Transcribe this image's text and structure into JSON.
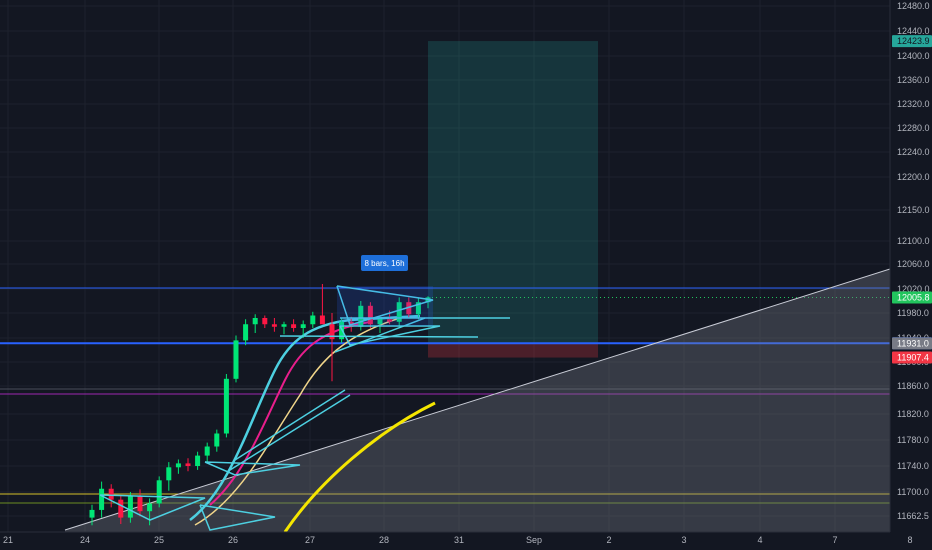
{
  "chart_data": {
    "type": "candlestick",
    "y_axis": {
      "labels": [
        "12480.0",
        "12440.0",
        "12400.0",
        "12360.0",
        "12320.0",
        "12280.0",
        "12240.0",
        "12200.0",
        "12150.0",
        "12100.0",
        "12060.0",
        "12020.0",
        "11980.0",
        "11940.0",
        "11900.0",
        "11860.0",
        "11820.0",
        "11780.0",
        "11740.0",
        "11700.0",
        "11662.5"
      ],
      "values": [
        12480,
        12440,
        12400,
        12360,
        12320,
        12280,
        12240,
        12200,
        12150,
        12100,
        12060,
        12020,
        11980,
        11940,
        11900,
        11860,
        11820,
        11780,
        11740,
        11700,
        11662.5
      ]
    },
    "x_axis": {
      "labels": [
        "21",
        "24",
        "25",
        "26",
        "27",
        "28",
        "31",
        "Sep",
        "2",
        "3",
        "4",
        "7",
        "8"
      ]
    },
    "price_badges": [
      {
        "label": "12423.9",
        "value": 12423.9,
        "bg": "#26a69a",
        "fg": "dark"
      },
      {
        "label": "12005.8",
        "value": 12005.8,
        "bg": "#22c55e",
        "fg": "light"
      },
      {
        "label": "11931.3",
        "value": 11931.3,
        "bg": "#2962ff",
        "fg": "light"
      },
      {
        "label": "11931.0",
        "value": 11931.0,
        "bg": "#787b86",
        "fg": "light"
      },
      {
        "label": "11907.4",
        "value": 11907.4,
        "bg": "#f23645",
        "fg": "light"
      }
    ],
    "range_tooltip": "8 bars, 16h",
    "candles": [
      {
        "o": 11660,
        "h": 11680,
        "l": 11648,
        "c": 11672
      },
      {
        "o": 11672,
        "h": 11716,
        "l": 11660,
        "c": 11705
      },
      {
        "o": 11705,
        "h": 11712,
        "l": 11676,
        "c": 11688
      },
      {
        "o": 11688,
        "h": 11694,
        "l": 11650,
        "c": 11660
      },
      {
        "o": 11660,
        "h": 11700,
        "l": 11652,
        "c": 11694
      },
      {
        "o": 11694,
        "h": 11704,
        "l": 11662,
        "c": 11670
      },
      {
        "o": 11670,
        "h": 11690,
        "l": 11648,
        "c": 11682
      },
      {
        "o": 11682,
        "h": 11724,
        "l": 11676,
        "c": 11718
      },
      {
        "o": 11718,
        "h": 11746,
        "l": 11702,
        "c": 11738
      },
      {
        "o": 11738,
        "h": 11750,
        "l": 11728,
        "c": 11744
      },
      {
        "o": 11744,
        "h": 11752,
        "l": 11732,
        "c": 11740
      },
      {
        "o": 11740,
        "h": 11762,
        "l": 11734,
        "c": 11756
      },
      {
        "o": 11756,
        "h": 11776,
        "l": 11744,
        "c": 11770
      },
      {
        "o": 11770,
        "h": 11796,
        "l": 11762,
        "c": 11790
      },
      {
        "o": 11790,
        "h": 11880,
        "l": 11784,
        "c": 11872
      },
      {
        "o": 11872,
        "h": 11944,
        "l": 11866,
        "c": 11936
      },
      {
        "o": 11936,
        "h": 11970,
        "l": 11928,
        "c": 11962
      },
      {
        "o": 11962,
        "h": 11978,
        "l": 11948,
        "c": 11972
      },
      {
        "o": 11972,
        "h": 11976,
        "l": 11956,
        "c": 11962
      },
      {
        "o": 11962,
        "h": 11972,
        "l": 11950,
        "c": 11958
      },
      {
        "o": 11958,
        "h": 11966,
        "l": 11946,
        "c": 11962
      },
      {
        "o": 11962,
        "h": 11970,
        "l": 11950,
        "c": 11956
      },
      {
        "o": 11956,
        "h": 11968,
        "l": 11940,
        "c": 11962
      },
      {
        "o": 11962,
        "h": 11982,
        "l": 11956,
        "c": 11976
      },
      {
        "o": 11976,
        "h": 12028,
        "l": 11970,
        "c": 11962
      },
      {
        "o": 11962,
        "h": 11980,
        "l": 11868,
        "c": 11938
      },
      {
        "o": 11938,
        "h": 11972,
        "l": 11932,
        "c": 11966
      },
      {
        "o": 11966,
        "h": 11974,
        "l": 11950,
        "c": 11958
      },
      {
        "o": 11958,
        "h": 12000,
        "l": 11952,
        "c": 11992
      },
      {
        "o": 11992,
        "h": 11998,
        "l": 11956,
        "c": 11962
      },
      {
        "o": 11962,
        "h": 11976,
        "l": 11948,
        "c": 11970
      },
      {
        "o": 11970,
        "h": 11984,
        "l": 11962,
        "c": 11966
      },
      {
        "o": 11966,
        "h": 12006,
        "l": 11958,
        "c": 11998
      },
      {
        "o": 11998,
        "h": 12006,
        "l": 11972,
        "c": 11978
      },
      {
        "o": 11978,
        "h": 12006,
        "l": 11970,
        "c": 11998
      },
      {
        "o": 11998,
        "h": 12008,
        "l": 11988,
        "c": 12006
      }
    ]
  }
}
